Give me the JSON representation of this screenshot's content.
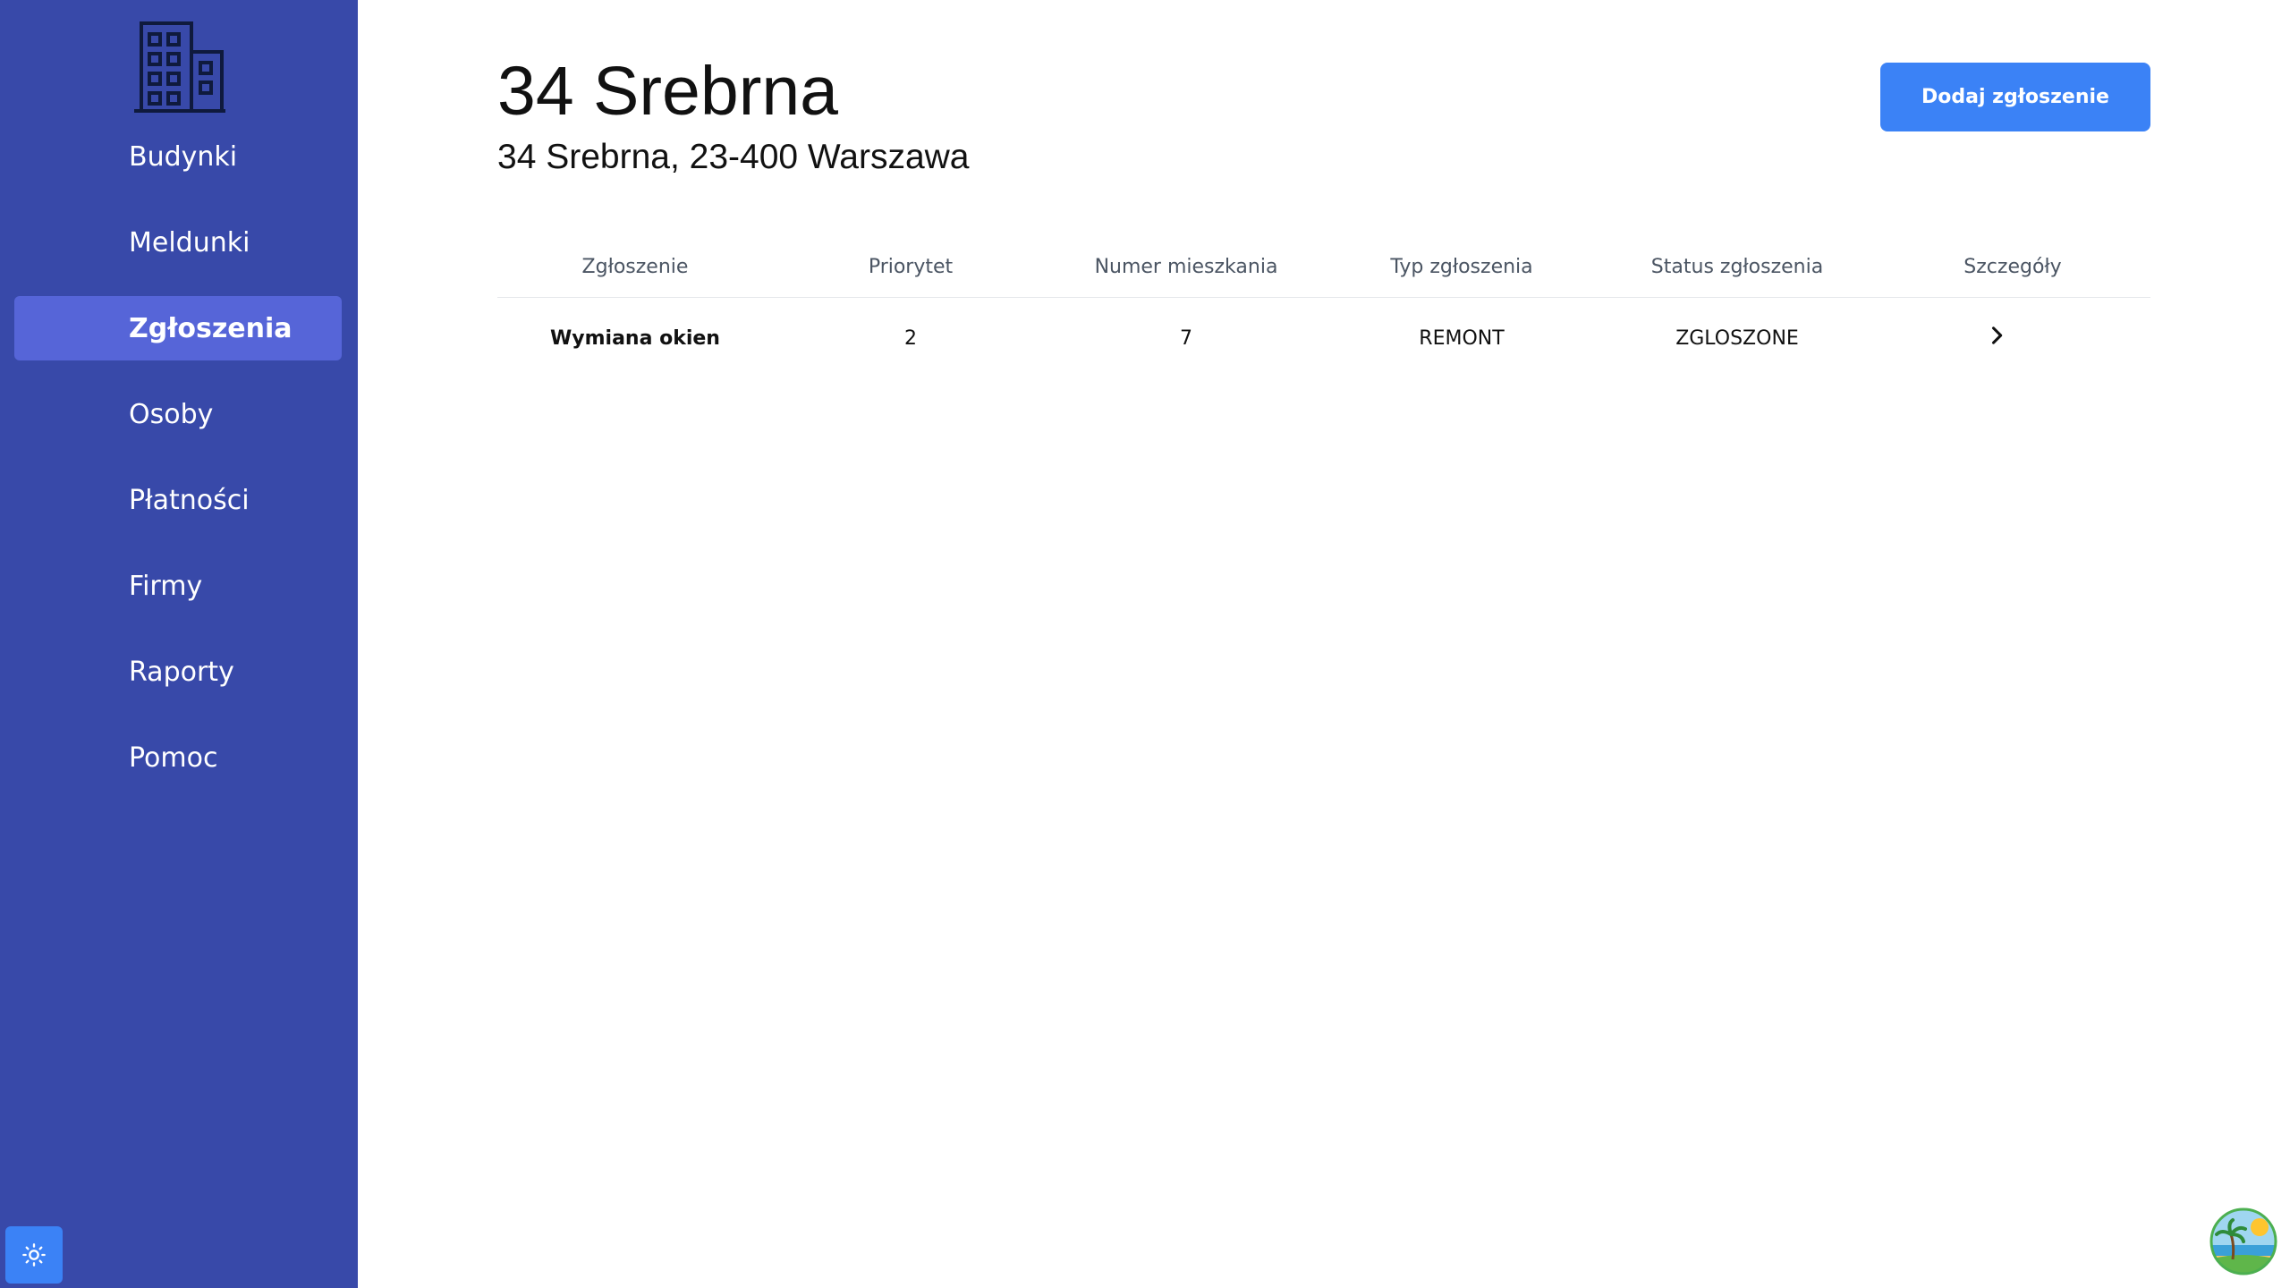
{
  "sidebar": {
    "logo_icon": "building-icon",
    "items": [
      {
        "label": "Budynki",
        "active": false
      },
      {
        "label": "Meldunki",
        "active": false
      },
      {
        "label": "Zgłoszenia",
        "active": true
      },
      {
        "label": "Osoby",
        "active": false
      },
      {
        "label": "Płatności",
        "active": false
      },
      {
        "label": "Firmy",
        "active": false
      },
      {
        "label": "Raporty",
        "active": false
      },
      {
        "label": "Pomoc",
        "active": false
      }
    ],
    "theme_toggle_icon": "sun-icon"
  },
  "header": {
    "title": "34 Srebrna",
    "subtitle": "34 Srebrna, 23-400 Warszawa",
    "add_button_label": "Dodaj zgłoszenie"
  },
  "table": {
    "columns": [
      "Zgłoszenie",
      "Priorytet",
      "Numer mieszkania",
      "Typ zgłoszenia",
      "Status zgłoszenia",
      "Szczegóły"
    ],
    "rows": [
      {
        "name": "Wymiana okien",
        "priority": "2",
        "apartment": "7",
        "type": "REMONT",
        "status": "ZGLOSZONE",
        "details_icon": "chevron-right-icon"
      }
    ]
  },
  "colors": {
    "sidebar_bg": "#3849a9",
    "sidebar_active": "#5665d8",
    "accent": "#3b82f6"
  }
}
